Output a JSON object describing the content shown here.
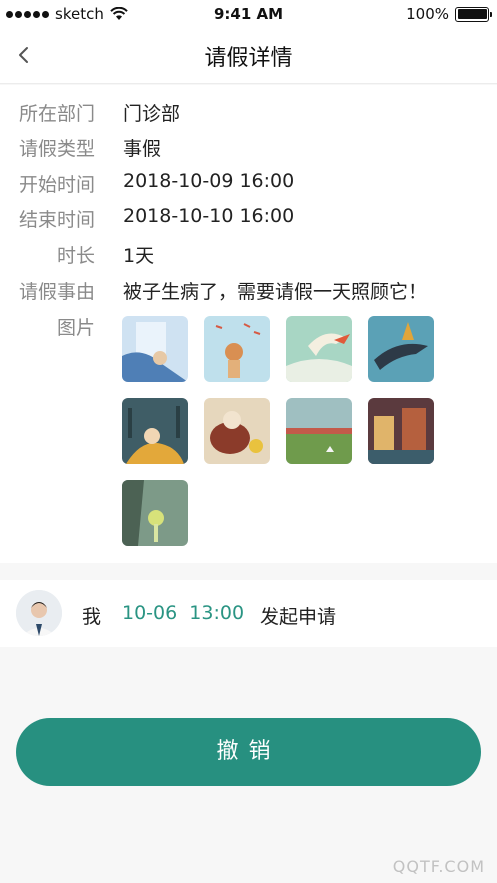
{
  "status_bar": {
    "carrier": "sketch",
    "time": "9:41 AM",
    "battery": "100%"
  },
  "nav": {
    "title": "请假详情"
  },
  "details": {
    "department_label": "所在部门",
    "department_value": "门诊部",
    "type_label": "请假类型",
    "type_value": "事假",
    "start_label": "开始时间",
    "start_value": "2018-10-09 16:00",
    "end_label": "结束时间",
    "end_value": "2018-10-10 16:00",
    "duration_label": "时长",
    "duration_value": "1天",
    "reason_label": "请假事由",
    "reason_value": "被子生病了，需要请假一天照顾它！",
    "images_label": "图片"
  },
  "record": {
    "name": "我",
    "time": "10-06  13:00",
    "action": "发起申请"
  },
  "button": {
    "revoke_label": "撤销"
  },
  "watermark": "QQTF.COM",
  "colors": {
    "accent": "#279080",
    "accent_text": "#2a9483"
  }
}
